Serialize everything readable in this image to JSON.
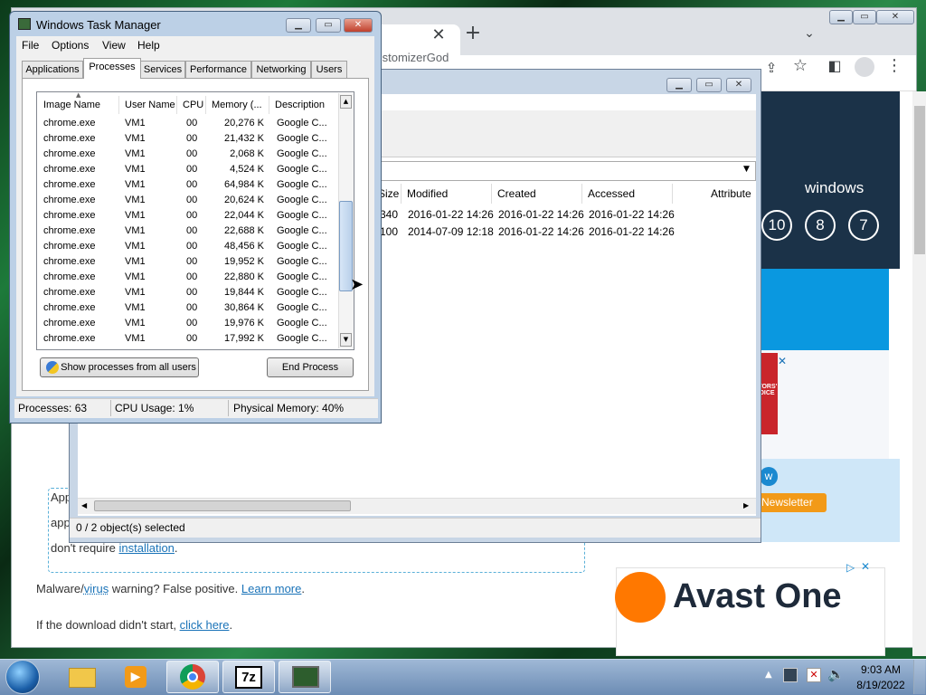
{
  "browser": {
    "omnibox_partial": "CustomizerGod",
    "site": {
      "windows_label": "windows",
      "version_circles": [
        "10",
        "8",
        "7"
      ],
      "pill_view": "w",
      "pill_newsletter": "Newsletter",
      "ad_badge_text": "EDITORS' CHOICE",
      "box_line1": "App",
      "box_line2": "app",
      "box_line3_prefix": "don't require ",
      "box_line3_link": "installation",
      "box_line3_suffix": ".",
      "malware_prefix": "Malware/",
      "malware_link": "virus",
      "malware_middle": " warning? False positive. ",
      "learn_more": "Learn more",
      "malware_suffix": ".",
      "download_prefix": "If the download didn't start, ",
      "click_here": "click here",
      "download_suffix": ".",
      "avast_text": "Avast One"
    }
  },
  "explorer": {
    "columns": [
      "Size",
      "Modified",
      "Created",
      "Accessed",
      "Attribute"
    ],
    "rows": [
      {
        "size": "340",
        "modified": "2016-01-22 14:26",
        "created": "2016-01-22 14:26",
        "accessed": "2016-01-22 14:26"
      },
      {
        "size": "100",
        "modified": "2014-07-09 12:18",
        "created": "2016-01-22 14:26",
        "accessed": "2016-01-22 14:26"
      }
    ],
    "status": "0 / 2 object(s) selected"
  },
  "taskmanager": {
    "title": "Windows Task Manager",
    "menu": [
      "File",
      "Options",
      "View",
      "Help"
    ],
    "tabs": [
      "Applications",
      "Processes",
      "Services",
      "Performance",
      "Networking",
      "Users"
    ],
    "columns": [
      "Image Name",
      "User Name",
      "CPU",
      "Memory (...",
      "Description"
    ],
    "processes": [
      {
        "name": "chrome.exe",
        "user": "VM1",
        "cpu": "00",
        "mem": "20,276 K",
        "desc": "Google C..."
      },
      {
        "name": "chrome.exe",
        "user": "VM1",
        "cpu": "00",
        "mem": "21,432 K",
        "desc": "Google C..."
      },
      {
        "name": "chrome.exe",
        "user": "VM1",
        "cpu": "00",
        "mem": "2,068 K",
        "desc": "Google C..."
      },
      {
        "name": "chrome.exe",
        "user": "VM1",
        "cpu": "00",
        "mem": "4,524 K",
        "desc": "Google C..."
      },
      {
        "name": "chrome.exe",
        "user": "VM1",
        "cpu": "00",
        "mem": "64,984 K",
        "desc": "Google C..."
      },
      {
        "name": "chrome.exe",
        "user": "VM1",
        "cpu": "00",
        "mem": "20,624 K",
        "desc": "Google C..."
      },
      {
        "name": "chrome.exe",
        "user": "VM1",
        "cpu": "00",
        "mem": "22,044 K",
        "desc": "Google C..."
      },
      {
        "name": "chrome.exe",
        "user": "VM1",
        "cpu": "00",
        "mem": "22,688 K",
        "desc": "Google C..."
      },
      {
        "name": "chrome.exe",
        "user": "VM1",
        "cpu": "00",
        "mem": "48,456 K",
        "desc": "Google C..."
      },
      {
        "name": "chrome.exe",
        "user": "VM1",
        "cpu": "00",
        "mem": "19,952 K",
        "desc": "Google C..."
      },
      {
        "name": "chrome.exe",
        "user": "VM1",
        "cpu": "00",
        "mem": "22,880 K",
        "desc": "Google C..."
      },
      {
        "name": "chrome.exe",
        "user": "VM1",
        "cpu": "00",
        "mem": "19,844 K",
        "desc": "Google C..."
      },
      {
        "name": "chrome.exe",
        "user": "VM1",
        "cpu": "00",
        "mem": "30,864 K",
        "desc": "Google C..."
      },
      {
        "name": "chrome.exe",
        "user": "VM1",
        "cpu": "00",
        "mem": "19,976 K",
        "desc": "Google C..."
      },
      {
        "name": "chrome.exe",
        "user": "VM1",
        "cpu": "00",
        "mem": "17,992 K",
        "desc": "Google C..."
      }
    ],
    "show_all_button": "Show processes from all users",
    "end_process_button": "End Process",
    "status": {
      "processes": "Processes: 63",
      "cpu": "CPU Usage: 1%",
      "memory": "Physical Memory: 40%"
    }
  },
  "taskbar": {
    "clock_time": "9:03 AM",
    "clock_date": "8/19/2022",
    "pinned": [
      "windows-explorer-icon",
      "media-player-icon",
      "chrome-icon",
      "7zip-icon",
      "task-manager-icon"
    ],
    "sevenzip_label": "7z"
  }
}
